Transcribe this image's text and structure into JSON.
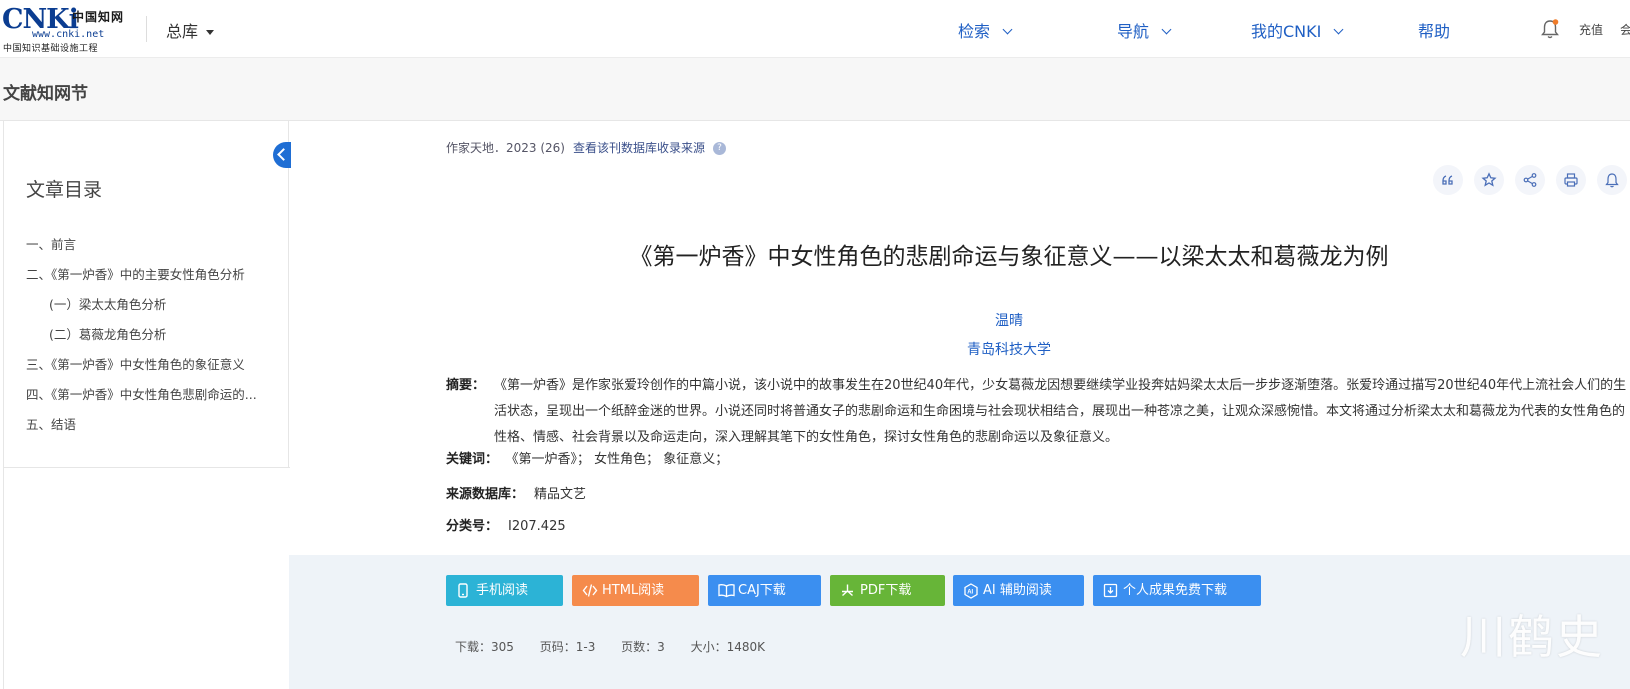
{
  "header": {
    "logo_text": "CNKi中国知网",
    "logo_url": "www.cnki.net",
    "logo_sub": "中国知识基础设施工程",
    "database_selector": "总库",
    "nav": [
      "检索",
      "导航",
      "我的CNKI",
      "帮助"
    ],
    "recharge": "充值",
    "more": "会"
  },
  "breadcrumb": {
    "title": "文献知网节"
  },
  "sidebar": {
    "toc_title": "文章目录",
    "items": [
      {
        "label": "一、前言",
        "sub": false
      },
      {
        "label": "二、《第一炉香》中的主要女性角色分析",
        "sub": false
      },
      {
        "label": "(一）梁太太角色分析",
        "sub": true
      },
      {
        "label": "(二）葛薇龙角色分析",
        "sub": true
      },
      {
        "label": "三、《第一炉香》中女性角色的象征意义",
        "sub": false
      },
      {
        "label": "四、《第一炉香》中女性角色悲剧命运的...",
        "sub": false
      },
      {
        "label": "五、结语",
        "sub": false
      }
    ]
  },
  "article": {
    "source": "作家天地．2023 (26)",
    "source_link": "查看该刊数据库收录来源",
    "title": "《第一炉香》中女性角色的悲剧命运与象征意义——以梁太太和葛薇龙为例",
    "author": "温晴",
    "organization": "青岛科技大学",
    "abstract_label": "摘要：",
    "abstract": "《第一炉香》是作家张爱玲创作的中篇小说，该小说中的故事发生在20世纪40年代，少女葛薇龙因想要继续学业投奔姑妈梁太太后一步步逐渐堕落。张爱玲通过描写20世纪40年代上流社会人们的生活状态，呈现出一个纸醉金迷的世界。小说还同时将普通女子的悲剧命运和生命困境与社会现状相结合，展现出一种苍凉之美，让观众深感惋惜。本文将通过分析梁太太和葛薇龙为代表的女性角色的性格、情感、社会背景以及命运走向，深入理解其笔下的女性角色，探讨女性角色的悲剧命运以及象征意义。",
    "keywords_label": "关键词：",
    "keywords": "《第一炉香》；  女性角色；  象征意义；",
    "database_label": "来源数据库：",
    "database": "精品文艺",
    "class_label": "分类号：",
    "class_no": "I207.425"
  },
  "actions": [
    {
      "label": "手机阅读",
      "icon": "phone-icon",
      "color": "#2cb3d6"
    },
    {
      "label": "HTML阅读",
      "icon": "code-icon",
      "color": "#f58b4c"
    },
    {
      "label": "CAJ下载",
      "icon": "book-icon",
      "color": "#3b8ff0"
    },
    {
      "label": "PDF下载",
      "icon": "pdf-icon",
      "color": "#67b538"
    },
    {
      "label": "AI 辅助阅读",
      "icon": "ai-icon",
      "color": "#3b8ff0"
    },
    {
      "label": "个人成果免费下载",
      "icon": "download-icon",
      "color": "#3b8ff0"
    }
  ],
  "stats": {
    "downloads": "下载：305",
    "pages": "页码：1-3",
    "page_count": "页数：3",
    "size": "大小：1480K"
  },
  "watermark": "川鹤史",
  "colors": {
    "link": "#1f5fc4",
    "primary": "#1f6ed4"
  }
}
